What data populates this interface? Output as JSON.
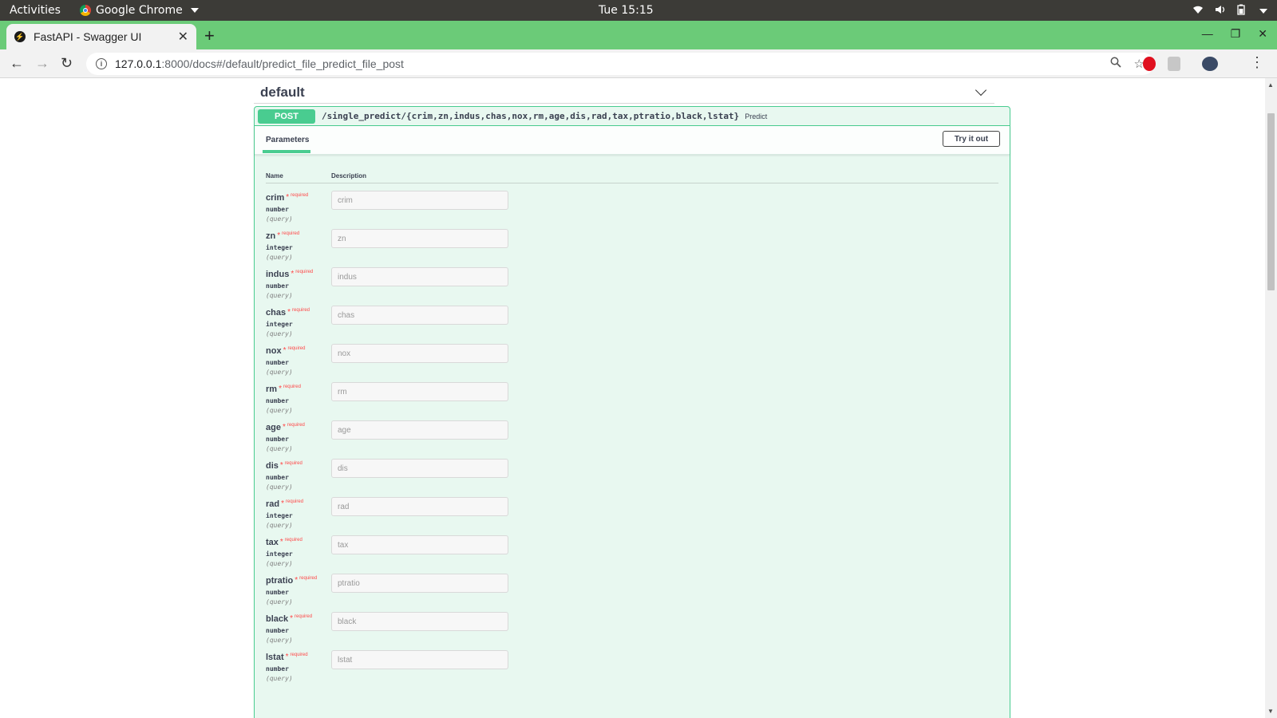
{
  "os": {
    "activities": "Activities",
    "app_name": "Google Chrome",
    "clock": "Tue 15:15"
  },
  "browser": {
    "tab_title": "FastAPI - Swagger UI",
    "url_host": "127.0.0.1",
    "url_path": ":8000/docs#/default/predict_file_predict_file_post"
  },
  "swagger": {
    "section_title": "default",
    "method": "POST",
    "path": "/single_predict/{crim,zn,indus,chas,nox,rm,age,dis,rad,tax,ptratio,black,lstat}",
    "summary": "Predict",
    "parameters_tab": "Parameters",
    "try_button": "Try it out",
    "col_name": "Name",
    "col_description": "Description",
    "required_label": "required",
    "params": [
      {
        "name": "crim",
        "type": "number",
        "in": "(query)",
        "placeholder": "crim"
      },
      {
        "name": "zn",
        "type": "integer",
        "in": "(query)",
        "placeholder": "zn"
      },
      {
        "name": "indus",
        "type": "number",
        "in": "(query)",
        "placeholder": "indus"
      },
      {
        "name": "chas",
        "type": "integer",
        "in": "(query)",
        "placeholder": "chas"
      },
      {
        "name": "nox",
        "type": "number",
        "in": "(query)",
        "placeholder": "nox"
      },
      {
        "name": "rm",
        "type": "number",
        "in": "(query)",
        "placeholder": "rm"
      },
      {
        "name": "age",
        "type": "number",
        "in": "(query)",
        "placeholder": "age"
      },
      {
        "name": "dis",
        "type": "number",
        "in": "(query)",
        "placeholder": "dis"
      },
      {
        "name": "rad",
        "type": "integer",
        "in": "(query)",
        "placeholder": "rad"
      },
      {
        "name": "tax",
        "type": "integer",
        "in": "(query)",
        "placeholder": "tax"
      },
      {
        "name": "ptratio",
        "type": "number",
        "in": "(query)",
        "placeholder": "ptratio"
      },
      {
        "name": "black",
        "type": "number",
        "in": "(query)",
        "placeholder": "black"
      },
      {
        "name": "lstat",
        "type": "number",
        "in": "(query)",
        "placeholder": "lstat"
      }
    ]
  },
  "colors": {
    "post_green": "#49cc90",
    "tab_strip": "#6bcb78",
    "required_red": "#ff4747"
  }
}
